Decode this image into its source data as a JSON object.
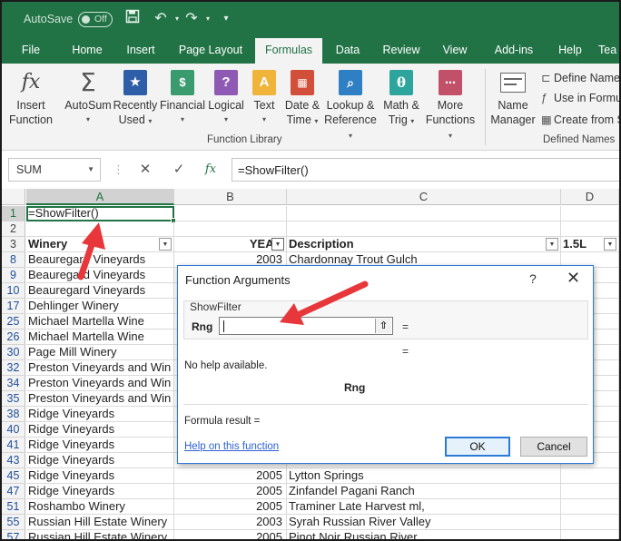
{
  "titlebar": {
    "autosave_label": "AutoSave",
    "autosave_state": "Off"
  },
  "tabs": [
    "File",
    "Home",
    "Insert",
    "Page Layout",
    "Formulas",
    "Data",
    "Review",
    "View",
    "Add-ins",
    "Help",
    "Tea"
  ],
  "active_tab": "Formulas",
  "ribbon": {
    "insert_function": [
      "Insert",
      "Function"
    ],
    "autosum": "AutoSum",
    "recently_used": [
      "Recently",
      "Used"
    ],
    "financial": "Financial",
    "logical": "Logical",
    "text": "Text",
    "date_time": [
      "Date &",
      "Time"
    ],
    "lookup_reference": [
      "Lookup &",
      "Reference"
    ],
    "math_trig": [
      "Math &",
      "Trig"
    ],
    "more_functions": [
      "More",
      "Functions"
    ],
    "name_manager": [
      "Name",
      "Manager"
    ],
    "define_name": "Define Name",
    "use_in_formula": "Use in Formu",
    "create_from": "Create from S",
    "group_function_library": "Function Library",
    "group_defined_names": "Defined Names"
  },
  "formula_bar": {
    "name_box": "SUM",
    "fx_label": "fx",
    "formula": "=ShowFilter()"
  },
  "grid": {
    "columns": [
      "A",
      "B",
      "C",
      "D"
    ],
    "rows": [
      {
        "n": "1",
        "a": "=ShowFilter()",
        "b": "",
        "c": "",
        "d": ""
      },
      {
        "n": "2",
        "a": "",
        "b": "",
        "c": "",
        "d": ""
      },
      {
        "n": "3",
        "a": "Winery",
        "b": "YEAR",
        "c": "Description",
        "d": "1.5L",
        "header": true
      },
      {
        "n": "8",
        "a": "Beauregard Vineyards",
        "b": "2003",
        "c": "Chardonnay Trout Gulch",
        "d": ""
      },
      {
        "n": "9",
        "a": "Beauregard Vineyards",
        "b": "",
        "c": "",
        "d": ""
      },
      {
        "n": "10",
        "a": "Beauregard Vineyards",
        "b": "",
        "c": "",
        "d": ""
      },
      {
        "n": "17",
        "a": "Dehlinger Winery",
        "b": "",
        "c": "",
        "d": ""
      },
      {
        "n": "25",
        "a": "Michael Martella Wine",
        "b": "",
        "c": "",
        "d": ""
      },
      {
        "n": "26",
        "a": "Michael Martella Wine",
        "b": "",
        "c": "",
        "d": ""
      },
      {
        "n": "30",
        "a": "Page Mill Winery",
        "b": "",
        "c": "",
        "d": ""
      },
      {
        "n": "32",
        "a": "Preston Vineyards and Win",
        "b": "",
        "c": "",
        "d": ""
      },
      {
        "n": "34",
        "a": "Preston Vineyards and Win",
        "b": "",
        "c": "",
        "d": ""
      },
      {
        "n": "35",
        "a": "Preston Vineyards and Win",
        "b": "",
        "c": "",
        "d": ""
      },
      {
        "n": "38",
        "a": "Ridge Vineyards",
        "b": "",
        "c": "",
        "d": ""
      },
      {
        "n": "40",
        "a": "Ridge Vineyards",
        "b": "",
        "c": "",
        "d": ""
      },
      {
        "n": "41",
        "a": "Ridge Vineyards",
        "b": "",
        "c": "",
        "d": ""
      },
      {
        "n": "43",
        "a": "Ridge Vineyards",
        "b": "",
        "c": "",
        "d": ""
      },
      {
        "n": "45",
        "a": "Ridge Vineyards",
        "b": "2005",
        "c": "Lytton Springs",
        "d": ""
      },
      {
        "n": "47",
        "a": "Ridge Vineyards",
        "b": "2005",
        "c": "Zinfandel Pagani Ranch",
        "d": ""
      },
      {
        "n": "51",
        "a": "Roshambo Winery",
        "b": "2005",
        "c": "Traminer Late Harvest ml,",
        "d": ""
      },
      {
        "n": "55",
        "a": "Russian Hill Estate Winery",
        "b": "2003",
        "c": "Syrah Russian River Valley",
        "d": ""
      },
      {
        "n": "57",
        "a": "Russian Hill Estate Winery",
        "b": "2005",
        "c": "Pinot Noir Russian River",
        "d": ""
      }
    ]
  },
  "dialog": {
    "title": "Function Arguments",
    "help_icon": "?",
    "close_icon": "✕",
    "function_name": "ShowFilter",
    "arg_label": "Rng",
    "arg_value": "",
    "equals": "=",
    "no_help": "No help available.",
    "arg_desc_label": "Rng",
    "formula_result": "Formula result =",
    "help_link": "Help on this function",
    "ok": "OK",
    "cancel": "Cancel"
  },
  "colors": {
    "excel_green": "#217346",
    "annotation_arrow": "#e8373a",
    "dialog_border": "#2b79d8"
  }
}
